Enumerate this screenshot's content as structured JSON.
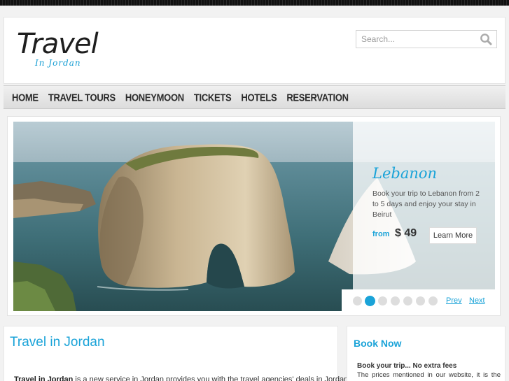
{
  "logo": {
    "main": "Travel",
    "sub": "In Jordan"
  },
  "search": {
    "placeholder": "Search..."
  },
  "nav": {
    "items": [
      "HOME",
      "TRAVEL TOURS",
      "HONEYMOON",
      "TICKETS",
      "HOTELS",
      "RESERVATION"
    ]
  },
  "slider": {
    "title": "Lebanon",
    "text": "Book your trip to Lebanon from 2 to 5 days and enjoy your stay in Beirut",
    "from_label": "from",
    "price": "$ 49",
    "button": "Learn More",
    "prev": "Prev",
    "next": "Next",
    "dot_count": 7,
    "active_dot": 1
  },
  "content": {
    "title": "Travel in Jordan",
    "lead_bold": "Travel in Jordan",
    "lead_text": " is a new service in Jordan provides you with the travel agencies' deals in Jordan."
  },
  "sidebar": {
    "title": "Book Now",
    "subtitle": "Book your trip... No extra fees",
    "text": "The prices mentioned in our website, it is the same prices of the providers, and we offer you"
  },
  "colors": {
    "accent": "#1aa3d8",
    "nav_text": "#2b2b2b"
  }
}
